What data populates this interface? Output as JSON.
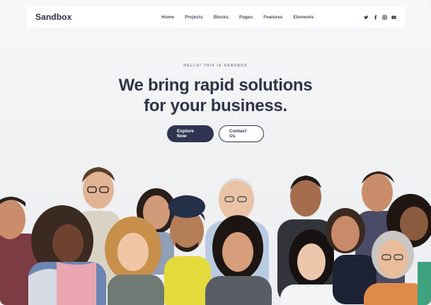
{
  "navbar": {
    "brand": "Sandbox",
    "links": [
      "Home",
      "Projects",
      "Blocks",
      "Pages",
      "Features",
      "Elements"
    ],
    "social": [
      {
        "icon": "twitter-icon"
      },
      {
        "icon": "facebook-icon"
      },
      {
        "icon": "instagram-icon"
      },
      {
        "icon": "youtube-icon"
      }
    ]
  },
  "hero": {
    "eyebrow": "HELLO! THIS IS SANDBOX",
    "headline_line1": "We bring rapid solutions",
    "headline_line2": "for your business.",
    "primary_button": "Explore Now",
    "secondary_button": "Contact Us"
  },
  "colors": {
    "accent": "#2f3550",
    "text": "#2e3448",
    "background": "#f1f2f4"
  }
}
